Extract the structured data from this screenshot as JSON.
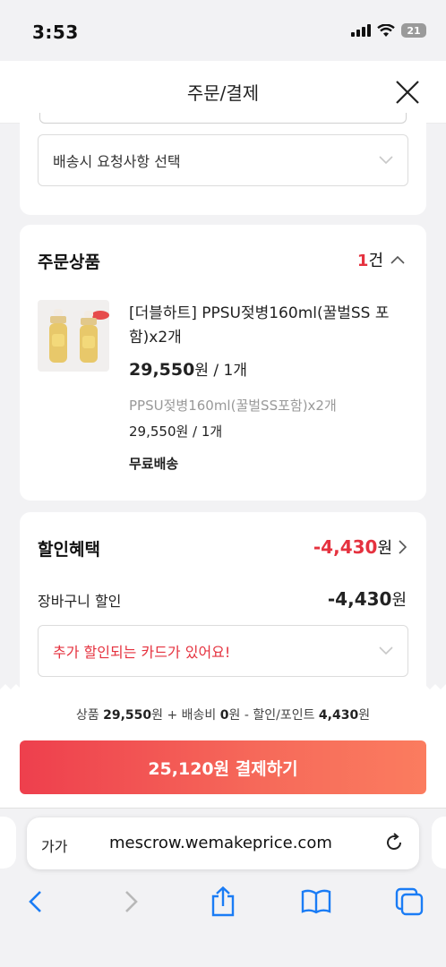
{
  "status": {
    "time": "3:53",
    "battery": "21"
  },
  "header": {
    "title": "주문/결제"
  },
  "delivery": {
    "request_placeholder": "배송시 요청사항 선택"
  },
  "order": {
    "title": "주문상품",
    "count": "1",
    "count_unit": "건",
    "product_name": "[더블하트] PPSU젖병160ml(꿀벌SS 포함)x2개",
    "price_value": "29,550",
    "price_suffix": "원 / 1개",
    "option_name": "PPSU젖병160ml(꿀벌SS포함)x2개",
    "option_price": "29,550원 / 1개",
    "shipping": "무료배송"
  },
  "discount": {
    "title": "할인혜택",
    "total_value": "-4,430",
    "total_unit": "원",
    "basket_label": "장바구니 할인",
    "basket_value": "-4,430",
    "basket_unit": "원",
    "card_notice": "추가 할인되는 카드가 있어요!"
  },
  "summary": {
    "product_label": "상품",
    "product_value": "29,550",
    "unit1": "원 +",
    "shipping_label": "배송비",
    "shipping_value": "0",
    "unit2": "원 -",
    "discount_label": "할인/포인트",
    "discount_value": "4,430",
    "unit3": "원"
  },
  "pay_button": "25,120원 결제하기",
  "browser": {
    "aa": "가가",
    "url": "mescrow.wemakeprice.com"
  },
  "icons": {
    "close": "close-icon",
    "chevron_down": "chevron-down-icon",
    "chevron_up": "chevron-up-icon",
    "chevron_right": "chevron-right-icon",
    "reload": "reload-icon",
    "back": "back-icon",
    "forward": "forward-icon",
    "share": "share-icon",
    "bookmarks": "bookmarks-icon",
    "tabs": "tabs-icon"
  },
  "colors": {
    "accent": "#e5323f",
    "pay_gradient_start": "#ee3f4d",
    "pay_gradient_end": "#fb7c5f",
    "safari_blue": "#1a7cf5"
  }
}
